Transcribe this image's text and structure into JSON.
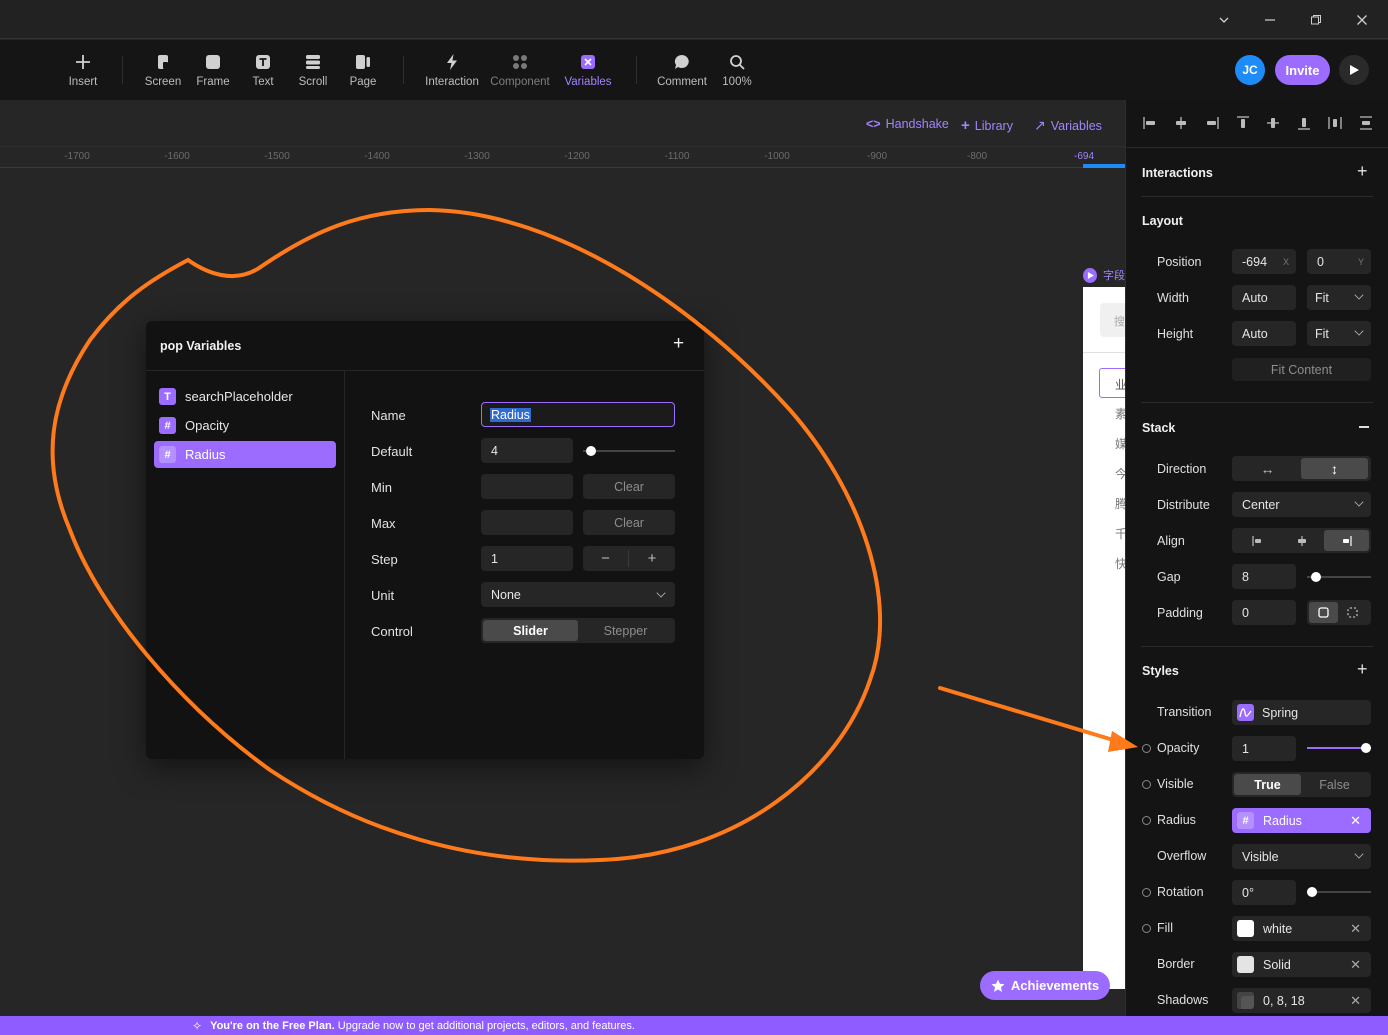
{
  "toolbar": {
    "items": [
      {
        "label": "Insert",
        "icon": "plus-icon"
      },
      {
        "label": "Screen",
        "icon": "screen-icon"
      },
      {
        "label": "Frame",
        "icon": "frame-icon"
      },
      {
        "label": "Text",
        "icon": "text-icon"
      },
      {
        "label": "Scroll",
        "icon": "scroll-icon"
      },
      {
        "label": "Page",
        "icon": "page-icon"
      },
      {
        "label": "Interaction",
        "icon": "bolt-icon"
      },
      {
        "label": "Component",
        "icon": "component-icon"
      },
      {
        "label": "Variables",
        "icon": "variables-icon",
        "active": true
      },
      {
        "label": "Comment",
        "icon": "comment-icon"
      },
      {
        "label": "100%",
        "icon": "zoom-icon"
      }
    ],
    "avatar_initials": "JC",
    "invite_label": "Invite"
  },
  "canvas_links": {
    "handshake": "Handshake",
    "library": "Library",
    "variables": "Variables"
  },
  "ruler": {
    "ticks": [
      "-1700",
      "-1600",
      "-1500",
      "-1400",
      "-1300",
      "-1200",
      "-1100",
      "-1000",
      "-900",
      "-800",
      "-694"
    ]
  },
  "popup": {
    "title": "pop Variables",
    "variables": [
      {
        "name": "searchPlaceholder",
        "type": "T"
      },
      {
        "name": "Opacity",
        "type": "#"
      },
      {
        "name": "Radius",
        "type": "#",
        "selected": true
      }
    ],
    "labels": {
      "name": "Name",
      "default": "Default",
      "min": "Min",
      "max": "Max",
      "step": "Step",
      "unit": "Unit",
      "control": "Control"
    },
    "values": {
      "name": "Radius",
      "default": "4",
      "min": "",
      "max": "",
      "step": "1",
      "unit": "None",
      "clear_min": "Clear",
      "clear_max": "Clear",
      "step_minus": "−",
      "step_plus": "+",
      "control_slider": "Slider",
      "control_stepper": "Stepper"
    }
  },
  "frame_preview": {
    "label": "字段",
    "search_text": "搜",
    "rows": [
      "业",
      "素",
      "媒",
      "今",
      "腾",
      "千",
      "快"
    ]
  },
  "achievements_label": "Achievements",
  "right_panel": {
    "interactions_title": "Interactions",
    "layout_title": "Layout",
    "position_label": "Position",
    "position_x": "-694",
    "position_x_unit": "X",
    "position_y": "0",
    "position_y_unit": "Y",
    "width_label": "Width",
    "width_value": "Auto",
    "width_mode": "Fit",
    "height_label": "Height",
    "height_value": "Auto",
    "height_mode": "Fit",
    "fit_content": "Fit Content",
    "stack_title": "Stack",
    "direction_label": "Direction",
    "distribute_label": "Distribute",
    "distribute_value": "Center",
    "align_label": "Align",
    "gap_label": "Gap",
    "gap_value": "8",
    "padding_label": "Padding",
    "padding_value": "0",
    "styles_title": "Styles",
    "transition_label": "Transition",
    "transition_value": "Spring",
    "opacity_label": "Opacity",
    "opacity_value": "1",
    "visible_label": "Visible",
    "visible_true": "True",
    "visible_false": "False",
    "radius_label": "Radius",
    "radius_value": "Radius",
    "overflow_label": "Overflow",
    "overflow_value": "Visible",
    "rotation_label": "Rotation",
    "rotation_value": "0°",
    "fill_label": "Fill",
    "fill_value": "white",
    "border_label": "Border",
    "border_value": "Solid",
    "shadows_label": "Shadows",
    "shadows_value": "0, 8, 18"
  },
  "banner": {
    "bold": "You're on the Free Plan.",
    "text": "Upgrade now to get additional projects, editors, and features."
  },
  "colors": {
    "accent": "#9b6cff",
    "annotation": "#ff7a1a",
    "banner": "#8f5cff"
  }
}
